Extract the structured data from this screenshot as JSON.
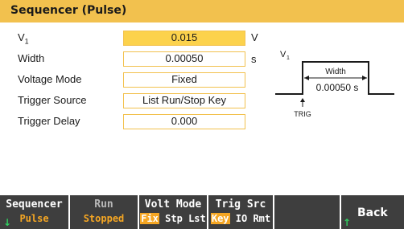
{
  "title": "Sequencer (Pulse)",
  "rows": [
    {
      "label_main": "V",
      "label_sub": "1",
      "value": "0.015",
      "unit": "V",
      "active": true
    },
    {
      "label": "Width",
      "value": "0.00050",
      "unit": "s"
    },
    {
      "label": "Voltage Mode",
      "value": "Fixed"
    },
    {
      "label": "Trigger Source",
      "value": "List Run/Stop Key"
    },
    {
      "label": "Trigger Delay",
      "value": "0.000"
    }
  ],
  "diagram": {
    "v_label": "V",
    "v_sub": "1",
    "width_label": "Width",
    "width_value": "0.00050 s",
    "trig_label": "TRIG"
  },
  "softkeys": [
    {
      "top": "Sequencer",
      "bottom": "Pulse"
    },
    {
      "top": "Run",
      "bottom": "Stopped"
    },
    {
      "top": "Volt Mode",
      "bottom_parts": [
        "Fix",
        "Stp",
        "Lst"
      ]
    },
    {
      "top": "Trig Src",
      "bottom_parts": [
        "Key",
        "IO",
        "Rmt"
      ]
    },
    {
      "top": "",
      "bottom": ""
    },
    {
      "top": "Back"
    }
  ],
  "colors": {
    "accent": "#f2c14e",
    "softkey_bg": "#3e3e3e",
    "softkey_highlight": "#f5a623"
  }
}
